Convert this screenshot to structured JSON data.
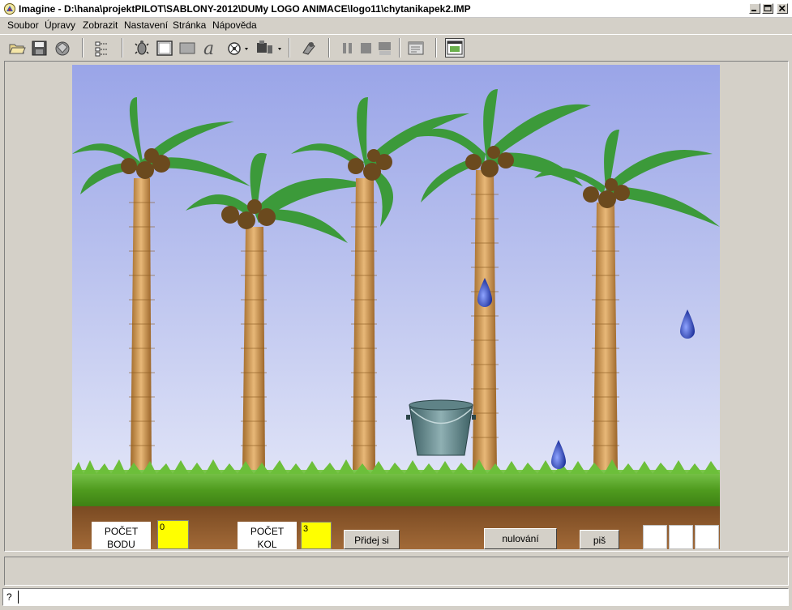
{
  "window": {
    "title": "Imagine - D:\\hana\\projektPILOT\\SABLONY-2012\\DUMy LOGO ANIMACE\\logo11\\chytanikapek2.IMP"
  },
  "menu": {
    "items": [
      "Soubor",
      "Úpravy",
      "Zobrazit",
      "Nastavení",
      "Stránka",
      "Nápověda"
    ]
  },
  "toolbar": {
    "icons": [
      "open-folder-icon",
      "save-disk-icon",
      "project-icon",
      "tree-view-icon",
      "turtle-icon",
      "frame-icon",
      "panel-icon",
      "text-a-icon",
      "media-icon",
      "tools-icon",
      "run-icon",
      "pause-icon",
      "stop-icon",
      "run-step-icon",
      "pages-icon",
      "screen-icon"
    ]
  },
  "scene": {
    "points_label": "POČET\nBODU",
    "points_value": "0",
    "rounds_label": "POČET\nKOL",
    "rounds_value": "3",
    "add_round_button": "Přidej si kolo",
    "reset_button": "nulování",
    "write_button": "piš",
    "colors": {
      "sky_top": "#9aa5e8",
      "grass": "#4f9b1e",
      "soil": "#8a5a2b",
      "value_box": "#ffff00",
      "drop": "#2a3fb0"
    }
  },
  "commandline": {
    "prompt": "?",
    "value": ""
  }
}
